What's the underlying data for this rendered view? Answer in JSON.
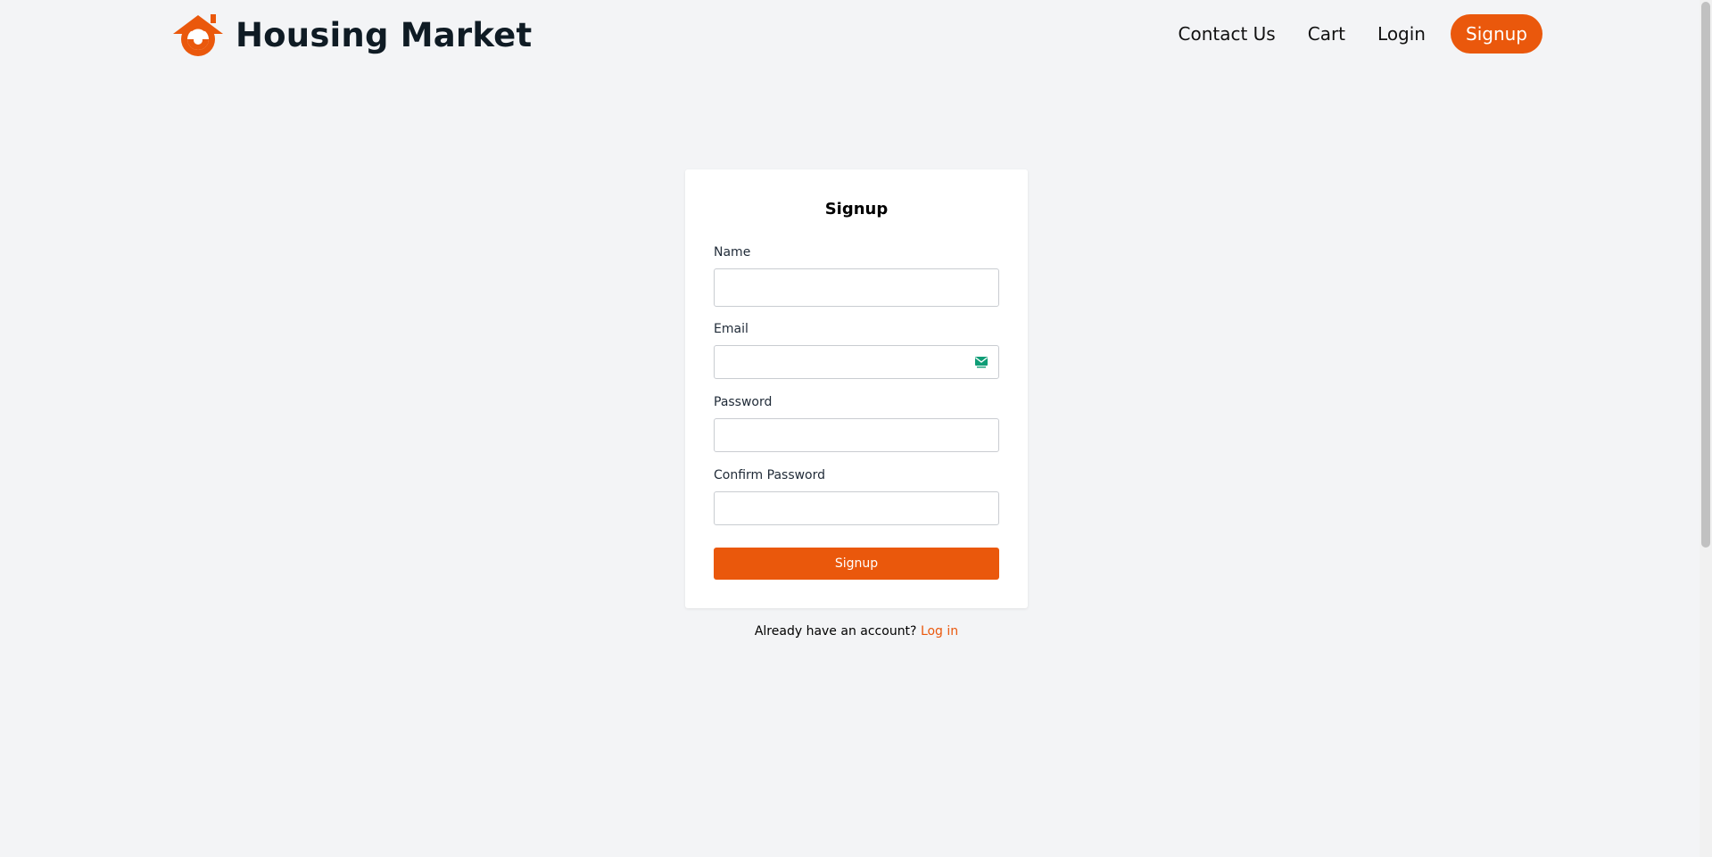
{
  "brand": {
    "name": "Housing Market",
    "logo_icon": "house-logo-icon",
    "accent": "#ea580c"
  },
  "nav": {
    "links": [
      "Contact Us",
      "Cart",
      "Login"
    ],
    "signup_label": "Signup"
  },
  "form": {
    "title": "Signup",
    "fields": [
      {
        "label": "Name",
        "value": "",
        "type": "text"
      },
      {
        "label": "Email",
        "value": "",
        "type": "email",
        "icon": "email-icon"
      },
      {
        "label": "Password",
        "value": "",
        "type": "password"
      },
      {
        "label": "Confirm Password",
        "value": "",
        "type": "password"
      }
    ],
    "submit_label": "Signup"
  },
  "footer": {
    "prompt": "Already have an account?",
    "login_link": "Log in"
  }
}
